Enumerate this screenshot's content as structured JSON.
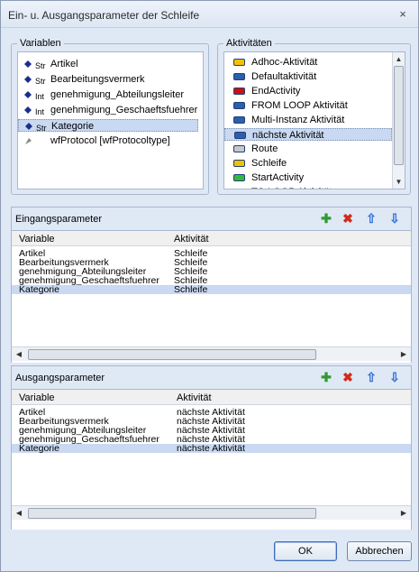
{
  "window": {
    "title": "Ein- u. Ausgangsparameter der Schleife",
    "close_glyph": "×"
  },
  "variables": {
    "legend": "Variablen",
    "items": [
      {
        "label": "Artikel",
        "type_icon": "str-icon"
      },
      {
        "label": "Bearbeitungsvermerk",
        "type_icon": "str-icon"
      },
      {
        "label": "genehmigung_Abteilungsleiter",
        "type_icon": "int-icon"
      },
      {
        "label": "genehmigung_Geschaeftsfuehrer",
        "type_icon": "int-icon"
      },
      {
        "label": "Kategorie",
        "type_icon": "str-icon",
        "selected": true
      },
      {
        "label": "wfProtocol [wfProtocoltype]",
        "type_icon": "object-icon"
      }
    ],
    "type_labels": {
      "str": "Str",
      "int": "Int"
    }
  },
  "activities": {
    "legend": "Aktivitäten",
    "items": [
      {
        "label": "Adhoc-Aktivität",
        "color": "#f2c200"
      },
      {
        "label": "Defaultaktivität",
        "color": "#2f5fa8"
      },
      {
        "label": "EndActivity",
        "color": "#cc1010"
      },
      {
        "label": "FROM LOOP Aktivität",
        "color": "#2f5fa8"
      },
      {
        "label": "Multi-Instanz Aktivität",
        "color": "#2f5fa8"
      },
      {
        "label": "nächste Aktivität",
        "color": "#2f5fa8",
        "selected": true
      },
      {
        "label": "Route",
        "color": "#c8c8c8"
      },
      {
        "label": "Schleife",
        "color": "#f2c200"
      },
      {
        "label": "StartActivity",
        "color": "#38b838"
      },
      {
        "label": "TO LOOP Aktivität",
        "color": "#2f5fa8"
      }
    ]
  },
  "eingang": {
    "title": "Eingangsparameter",
    "columns": [
      "Variable",
      "Aktivität"
    ],
    "rows": [
      [
        "Artikel",
        "Schleife"
      ],
      [
        "Bearbeitungsvermerk",
        "Schleife"
      ],
      [
        "genehmigung_Abteilungsleiter",
        "Schleife"
      ],
      [
        "genehmigung_Geschaeftsfuehrer",
        "Schleife"
      ],
      [
        "Kategorie",
        "Schleife"
      ]
    ],
    "selected_row": 4
  },
  "ausgang": {
    "title": "Ausgangsparameter",
    "columns": [
      "Variable",
      "Aktivität"
    ],
    "rows": [
      [
        "Artikel",
        "nächste Aktivität"
      ],
      [
        "Bearbeitungsvermerk",
        "nächste Aktivität"
      ],
      [
        "genehmigung_Abteilungsleiter",
        "nächste Aktivität"
      ],
      [
        "genehmigung_Geschaeftsfuehrer",
        "nächste Aktivität"
      ],
      [
        "Kategorie",
        "nächste Aktivität"
      ]
    ],
    "selected_row": 4
  },
  "toolbar_icons": {
    "add": "add-icon",
    "delete": "delete-icon",
    "up": "arrow-up-icon",
    "down": "arrow-down-icon"
  },
  "buttons": {
    "ok": "OK",
    "cancel": "Abbrechen"
  }
}
